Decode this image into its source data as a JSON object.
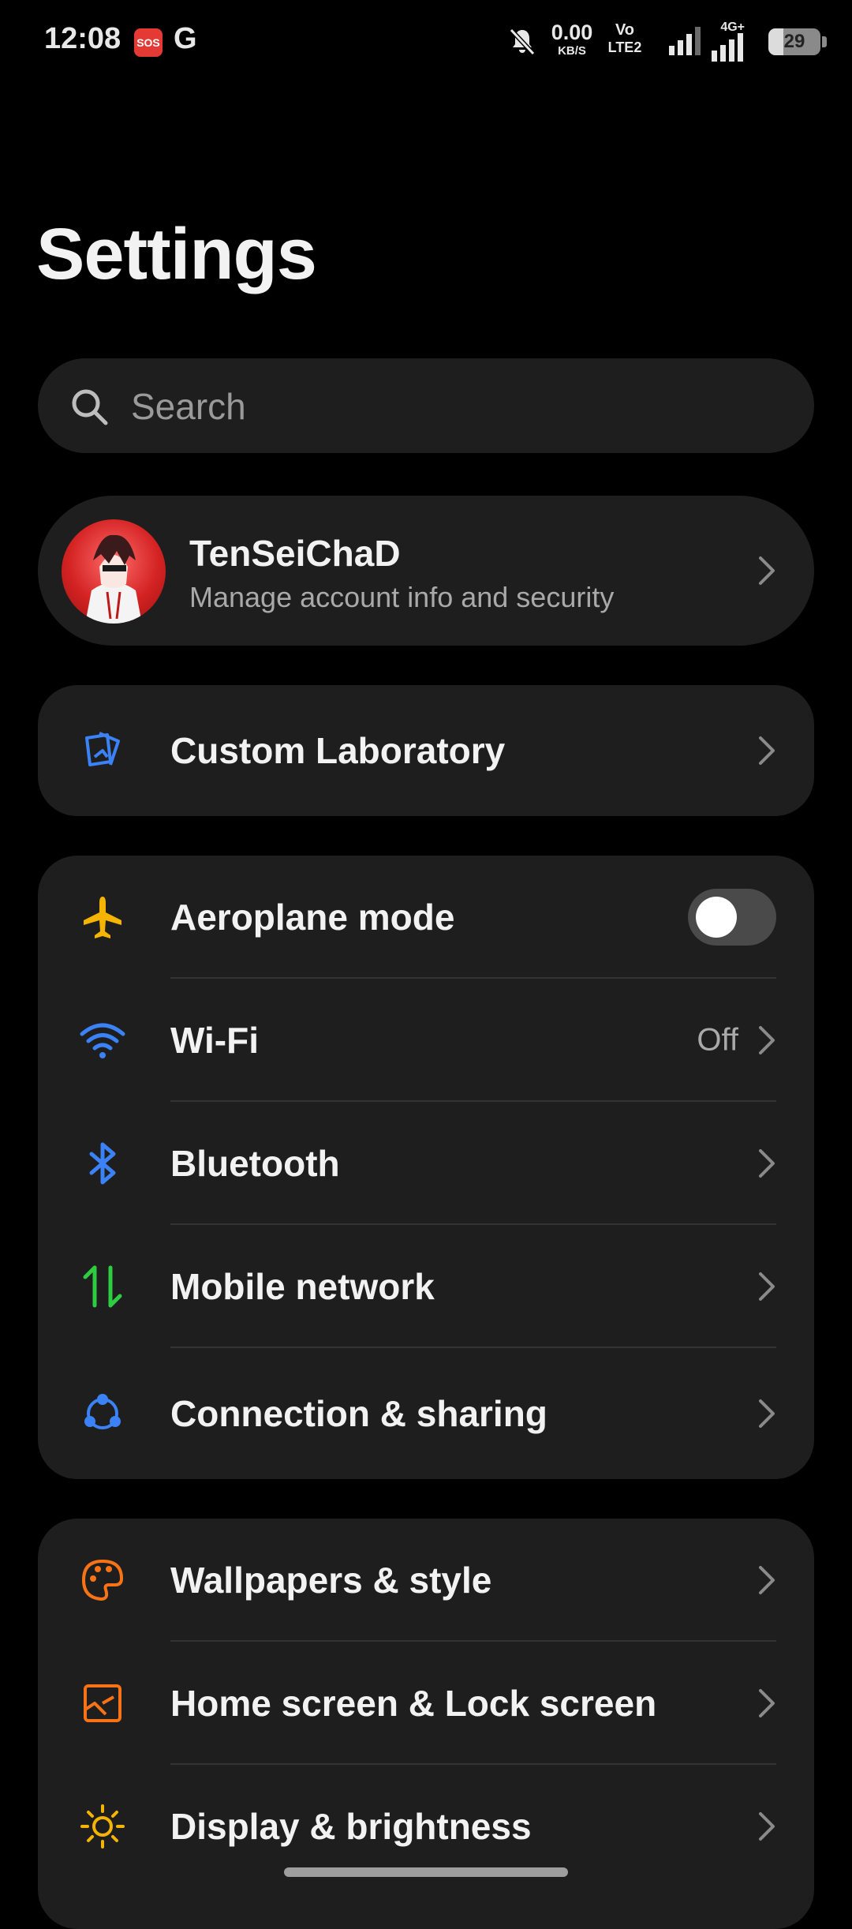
{
  "status_bar": {
    "time": "12:08",
    "sos": "SOS",
    "g": "G",
    "net_speed_value": "0.00",
    "net_speed_unit": "KB/S",
    "volte_top": "Vo",
    "volte_bottom": "LTE2",
    "net_type": "4G+",
    "battery": "29",
    "battery_level": 0.29
  },
  "header": {
    "title": "Settings"
  },
  "search": {
    "placeholder": "Search"
  },
  "account": {
    "name": "TenSeiChaD",
    "subtitle": "Manage account info and security"
  },
  "lab": {
    "label": "Custom Laboratory",
    "icon": "custom-laboratory-icon",
    "color": "#3b82f6"
  },
  "connectivity": [
    {
      "label": "Aeroplane mode",
      "icon": "airplane-icon",
      "color": "#f5b400",
      "toggle": false
    },
    {
      "label": "Wi-Fi",
      "icon": "wifi-icon",
      "color": "#3b82f6",
      "value": "Off"
    },
    {
      "label": "Bluetooth",
      "icon": "bluetooth-icon",
      "color": "#3b82f6"
    },
    {
      "label": "Mobile network",
      "icon": "mobile-data-icon",
      "color": "#2ecc40"
    },
    {
      "label": "Connection & sharing",
      "icon": "share-icon",
      "color": "#3b82f6"
    }
  ],
  "personalization": [
    {
      "label": "Wallpapers & style",
      "icon": "palette-icon",
      "color": "#f97316"
    },
    {
      "label": "Home screen & Lock screen",
      "icon": "home-lock-screen-icon",
      "color": "#f97316"
    },
    {
      "label": "Display & brightness",
      "icon": "sun-icon",
      "color": "#f5b400"
    }
  ]
}
